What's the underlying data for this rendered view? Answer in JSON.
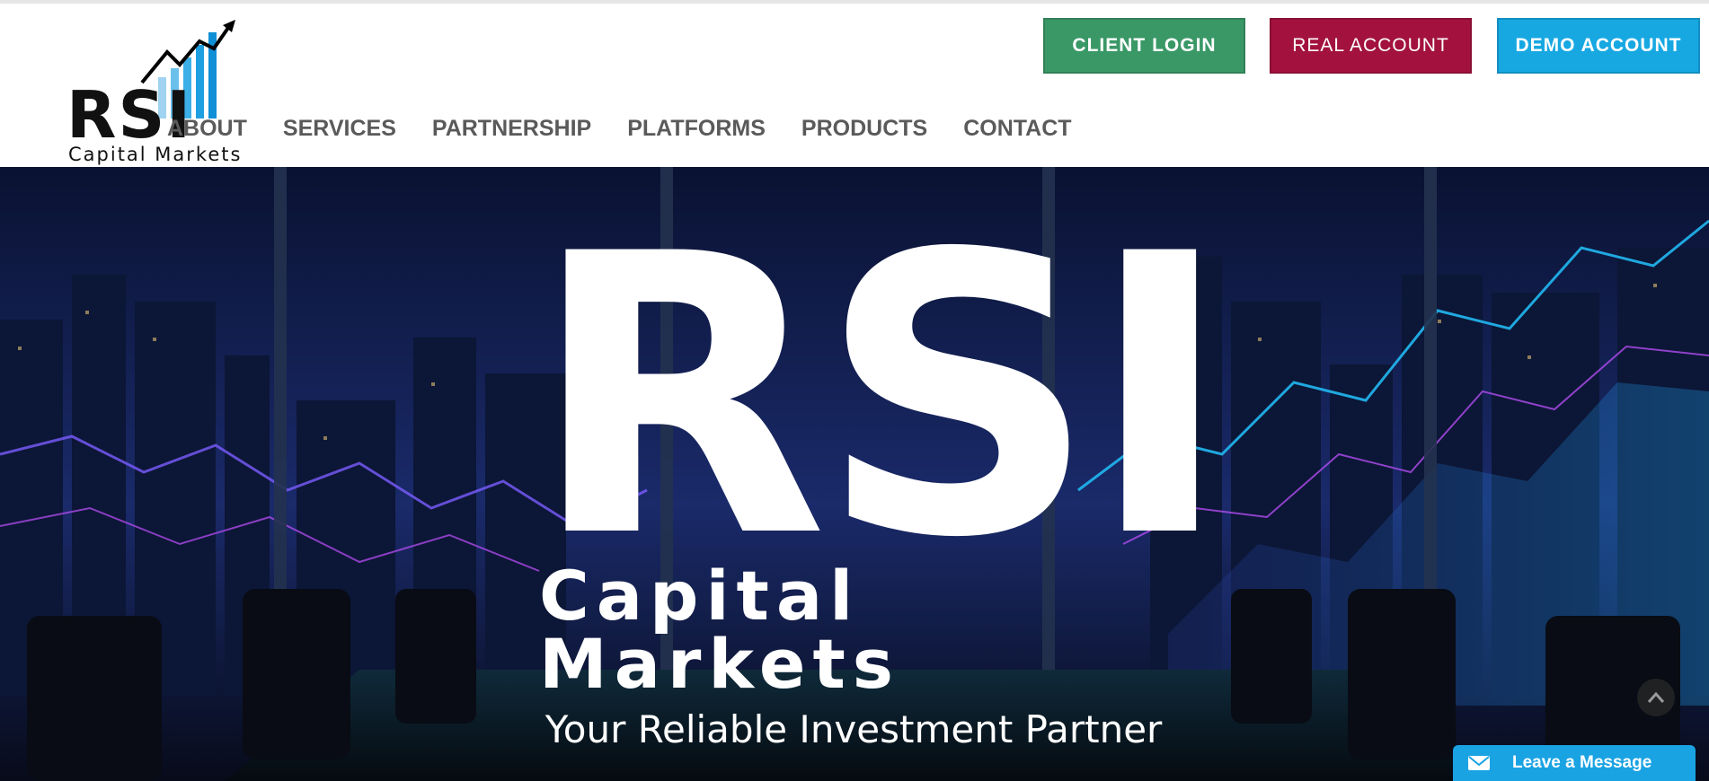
{
  "header": {
    "logo": {
      "word": "RSI",
      "subtitle": "Capital Markets"
    },
    "nav": [
      {
        "label": "ABOUT"
      },
      {
        "label": "SERVICES"
      },
      {
        "label": "PARTNERSHIP"
      },
      {
        "label": "PLATFORMS"
      },
      {
        "label": "PRODUCTS"
      },
      {
        "label": "CONTACT"
      }
    ],
    "buttons": {
      "client_login": "CLIENT LOGIN",
      "real_account": "REAL ACCOUNT",
      "demo_account": "DEMO ACCOUNT"
    }
  },
  "hero": {
    "title": "RSI",
    "subtitle": "Capital Markets",
    "tagline": "Your Reliable Investment Partner"
  },
  "widgets": {
    "leave_message": "Leave a Message",
    "scroll_top_icon": "chevron-up-icon",
    "message_icon": "envelope-icon"
  },
  "colors": {
    "client_login": "#3a9867",
    "real_account": "#a3123f",
    "demo_account": "#17a8e2",
    "nav_text": "#5a5a5a",
    "leave_message": "#1aa3e3"
  }
}
